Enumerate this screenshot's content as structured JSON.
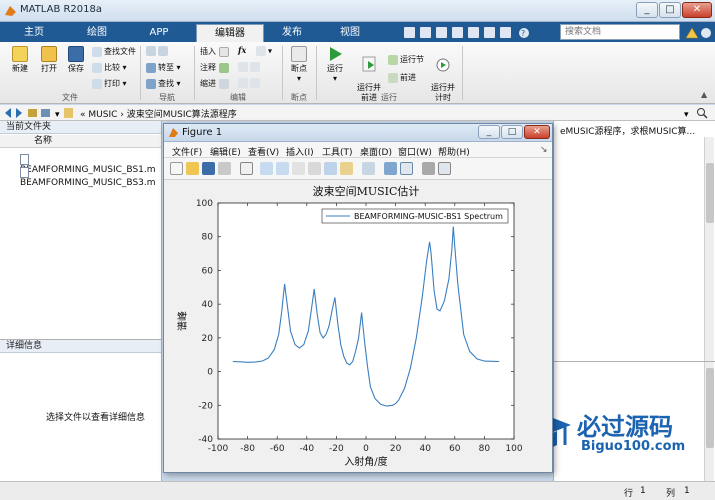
{
  "window": {
    "title": "MATLAB R2018a",
    "controls": [
      "_",
      "□",
      "✕"
    ]
  },
  "tabs": [
    "主页",
    "绘图",
    "APP",
    "编辑器",
    "发布",
    "视图"
  ],
  "active_tab": "编辑器",
  "search": {
    "placeholder": "搜索文档"
  },
  "ribbon": {
    "file": {
      "new": "新建",
      "open": "打开",
      "save": "保存",
      "find_files": "查找文件",
      "compare": "比较",
      "print": "打印",
      "group": "文件"
    },
    "navigate": {
      "goto": "转至",
      "find": "查找",
      "group": "导航"
    },
    "edit": {
      "insert": "插入",
      "comment": "注释",
      "indent": "缩进",
      "fx": "fx",
      "group": "编辑"
    },
    "breakpoints": {
      "breakpoint": "断点",
      "group": "断点"
    },
    "run": {
      "run": "运行",
      "run_and_advance": "运行并\n前进",
      "run_section": "运行节",
      "advance": "前进",
      "run_and_time": "运行并\n计时",
      "group": "运行"
    }
  },
  "address": {
    "prefix": "«",
    "path": [
      "MUSIC",
      "波束空间MUSIC算法源程序"
    ]
  },
  "current_folder": {
    "title": "当前文件夹",
    "column": "名称",
    "files": [
      "BEAMFORMING_MUSIC_BS1.m",
      "BEAMFORMING_MUSIC_BS3.m"
    ]
  },
  "details": {
    "title": "详细信息",
    "hint": "选择文件以查看详细信息"
  },
  "editor": {
    "snippet": "eMUSIC源程序，求根MUSIC算..."
  },
  "status": {
    "row_label": "行",
    "row_value": "1",
    "col_label": "列",
    "col_value": "1"
  },
  "figure": {
    "title": "Figure 1",
    "menu": [
      "文件(F)",
      "编辑(E)",
      "查看(V)",
      "插入(I)",
      "工具(T)",
      "桌面(D)",
      "窗口(W)",
      "帮助(H)"
    ]
  },
  "watermark": {
    "cn": "必过源码",
    "url": "Biguo100.com"
  },
  "colors": {
    "accent": "#1f5a95",
    "line": "#3a7fc1",
    "watermark": "#1c63b0"
  },
  "chart_data": {
    "type": "line",
    "title": "波束空间MUSIC估计",
    "xlabel": "入射角/度",
    "ylabel": "谱峰",
    "xlim": [
      -100,
      100
    ],
    "ylim": [
      -40,
      100
    ],
    "xticks": [
      -100,
      -80,
      -60,
      -40,
      -20,
      0,
      20,
      40,
      60,
      80,
      100
    ],
    "yticks": [
      -40,
      -20,
      0,
      20,
      40,
      60,
      80,
      100
    ],
    "legend": {
      "position": "top-right",
      "entries": [
        "BEAMFORMING-MUSIC-BS1 Spectrum"
      ]
    },
    "series": [
      {
        "name": "BEAMFORMING-MUSIC-BS1 Spectrum",
        "x": [
          -90,
          -85,
          -80,
          -75,
          -70,
          -66,
          -62,
          -59,
          -57,
          -55,
          -53,
          -51,
          -48,
          -45,
          -42,
          -39,
          -37,
          -35,
          -33,
          -31,
          -29,
          -27,
          -25,
          -23,
          -21,
          -19,
          -17,
          -15,
          -13,
          -11,
          -9,
          -7,
          -5,
          -3,
          -1,
          1,
          3,
          6,
          10,
          14,
          18,
          20,
          22,
          26,
          30,
          34,
          38,
          41,
          43,
          44,
          46,
          48,
          50,
          53,
          56,
          58,
          59,
          60,
          62,
          66,
          70,
          75,
          80,
          85,
          90
        ],
        "y": [
          6,
          5.8,
          5.5,
          5.6,
          6.3,
          8,
          13,
          22,
          35,
          52,
          38,
          24,
          16,
          14,
          16,
          24,
          36,
          49,
          34,
          23,
          20,
          22,
          27,
          36,
          44,
          28,
          16,
          9,
          5,
          4,
          6,
          12,
          20,
          35,
          18,
          3,
          -9,
          -16,
          -19.5,
          -20.5,
          -20,
          -19,
          -17,
          -10,
          2,
          20,
          44,
          66,
          77,
          70,
          48,
          37,
          36,
          42,
          55,
          72,
          86,
          74,
          52,
          22,
          12,
          7.5,
          6.2,
          6.1,
          6
        ]
      }
    ]
  }
}
